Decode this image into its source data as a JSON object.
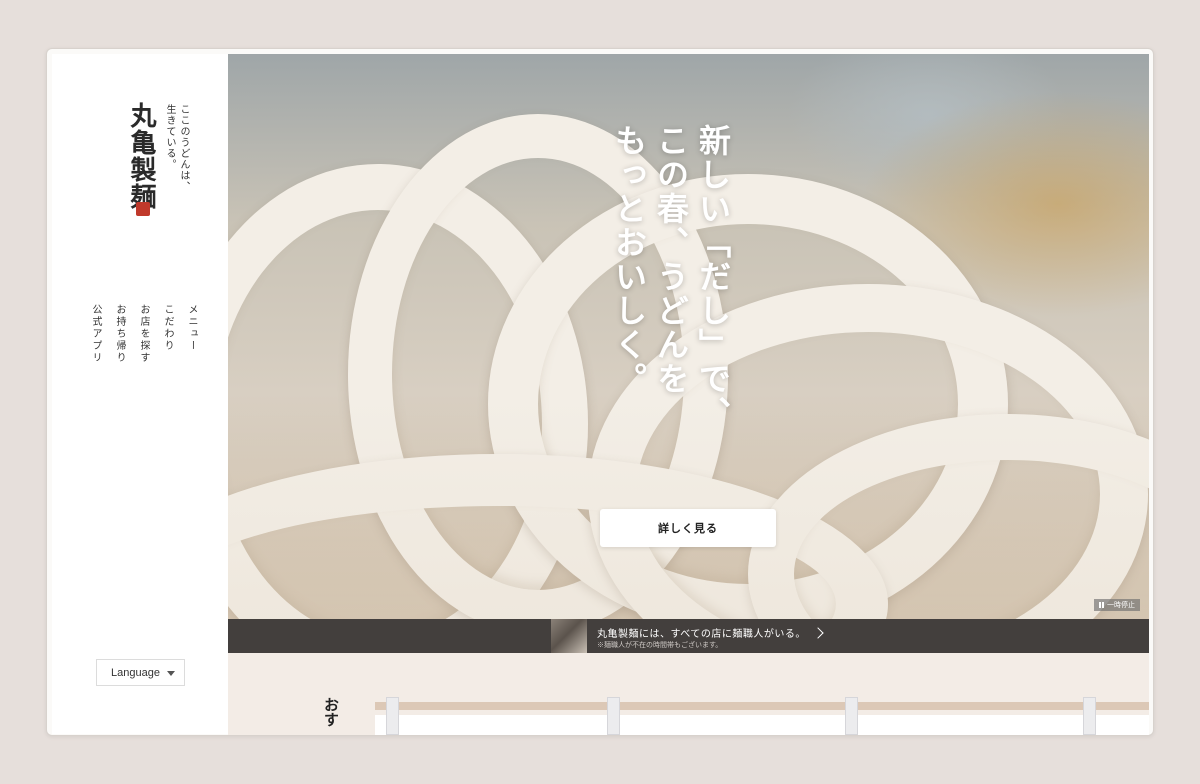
{
  "sidebar": {
    "logo": "丸亀製麺",
    "tagline": "ここのうどんは、生きている。",
    "nav": [
      {
        "label": "メニュー"
      },
      {
        "label": "こだわり"
      },
      {
        "label": "お店を探す"
      },
      {
        "label": "お持ち帰り"
      },
      {
        "label": "公式アプリ"
      }
    ],
    "language_label": "Language"
  },
  "hero": {
    "catch_lines": [
      "新しい「だし」で、",
      "この春、うどんを",
      "もっとおいしく。"
    ],
    "detail_button": "詳しく見る",
    "pause_label": "一時停止"
  },
  "banner": {
    "title": "丸亀製麺には、すべての店に麺職人がいる。",
    "note": "※麺職人が不在の時間帯もございます。"
  },
  "lower": {
    "heading": "おす"
  },
  "colors": {
    "page_bg": "#e6dfdb",
    "banner_bg": "#433f3d",
    "seal": "#c0392b",
    "lower_bg": "#f3ece6"
  }
}
